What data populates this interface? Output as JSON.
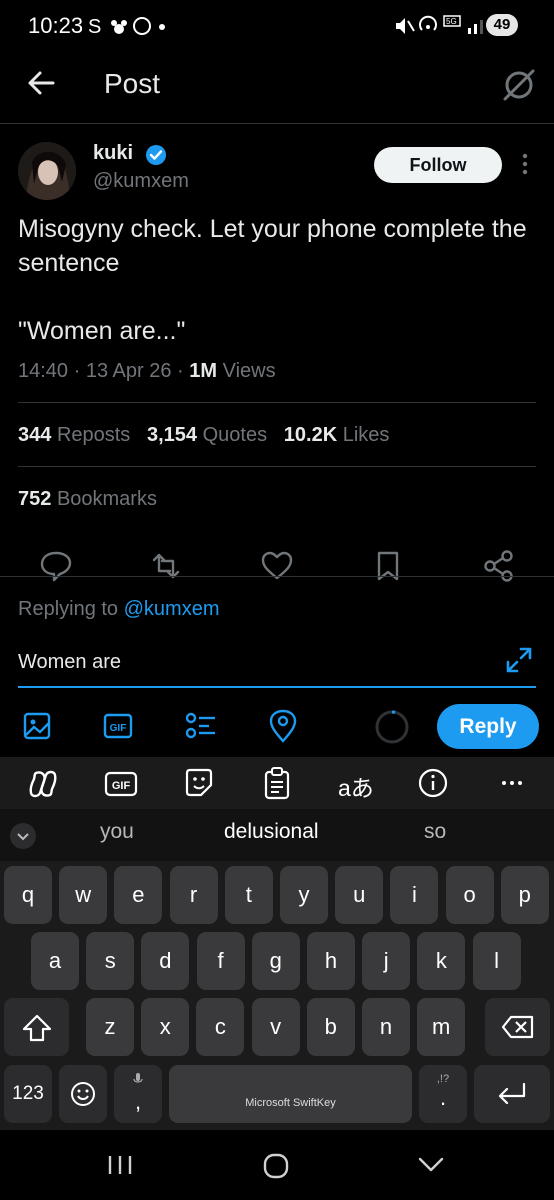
{
  "status_bar": {
    "time": "10:23",
    "battery": "49"
  },
  "header": {
    "title": "Post"
  },
  "post": {
    "author_name": "kuki",
    "author_handle": "@kumxem",
    "follow_label": "Follow",
    "text": "Misogyny check. Let your phone complete the sentence\n\n\"Women are...\"",
    "time": "14:40",
    "date": "13 Apr 26",
    "views_count": "1M",
    "views_label": "Views",
    "reposts_count": "344",
    "reposts_label": "Reposts",
    "quotes_count": "3,154",
    "quotes_label": "Quotes",
    "likes_count": "10.2K",
    "likes_label": "Likes",
    "bookmarks_count": "752",
    "bookmarks_label": "Bookmarks"
  },
  "reply": {
    "replying_prefix": "Replying to",
    "replying_to": "@kumxem",
    "input_value": "Women are",
    "reply_label": "Reply"
  },
  "keyboard": {
    "suggestions": [
      "you",
      "delusional",
      "so"
    ],
    "toolbar_gif": "GIF",
    "row1": [
      "q",
      "w",
      "e",
      "r",
      "t",
      "y",
      "u",
      "i",
      "o",
      "p"
    ],
    "row2": [
      "a",
      "s",
      "d",
      "f",
      "g",
      "h",
      "j",
      "k",
      "l"
    ],
    "row3": [
      "z",
      "x",
      "c",
      "v",
      "b",
      "n",
      "m"
    ],
    "numbers_key": "123",
    "comma_key": ",",
    "period_key": ".",
    "punct_hint": ",!?",
    "space_label": "Microsoft SwiftKey",
    "translate_label": "aあ"
  },
  "colors": {
    "accent": "#1d9bf0",
    "background": "#000000",
    "muted": "#71767b"
  }
}
